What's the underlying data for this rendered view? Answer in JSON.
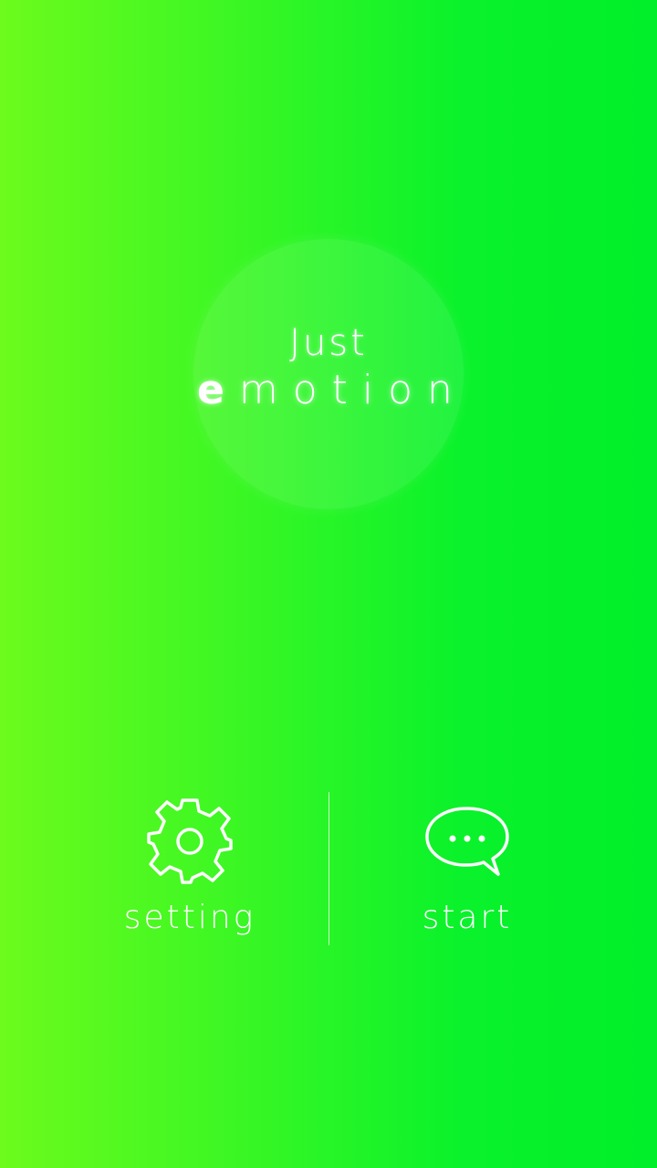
{
  "logo": {
    "line1": "Just",
    "line2_first": "e",
    "line2_rest": "motion"
  },
  "actions": {
    "setting": {
      "label": "setting",
      "icon": "gear-icon"
    },
    "start": {
      "label": "start",
      "icon": "chat-bubble-icon"
    }
  },
  "colors": {
    "gradient_left": "#6cfb1c",
    "gradient_right": "#00ef2a",
    "foreground": "#ffffff"
  }
}
